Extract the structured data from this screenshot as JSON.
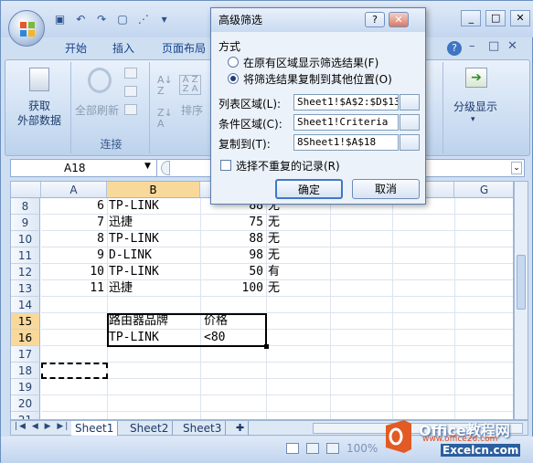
{
  "quick_access": {
    "dropdown": "▾"
  },
  "ribbon_tabs": [
    "开始",
    "插入",
    "页面布局"
  ],
  "help_icon": "?",
  "ribbon": {
    "get_external_data": "获取\n外部数据",
    "refresh_all": "全部刷新",
    "connections_group": "连接",
    "sort": "排序",
    "outline": "分级显示"
  },
  "formula_bar": {
    "name_box": "A18"
  },
  "columns": [
    "A",
    "B",
    "C",
    "D",
    "E",
    "F",
    "G"
  ],
  "rows": [
    {
      "n": "8",
      "a": "6",
      "b": "TP-LINK",
      "c": "88",
      "d": "无"
    },
    {
      "n": "9",
      "a": "7",
      "b": "迅捷",
      "c": "75",
      "d": "无"
    },
    {
      "n": "10",
      "a": "8",
      "b": "TP-LINK",
      "c": "88",
      "d": "无"
    },
    {
      "n": "11",
      "a": "9",
      "b": "D-LINK",
      "c": "98",
      "d": "无"
    },
    {
      "n": "12",
      "a": "10",
      "b": "TP-LINK",
      "c": "50",
      "d": "有"
    },
    {
      "n": "13",
      "a": "11",
      "b": "迅捷",
      "c": "100",
      "d": "无"
    },
    {
      "n": "14",
      "a": "",
      "b": "",
      "c": "",
      "d": ""
    },
    {
      "n": "15",
      "a": "",
      "b": "路由器品牌",
      "c": "价格",
      "d": ""
    },
    {
      "n": "16",
      "a": "",
      "b": "TP-LINK",
      "c": "<80",
      "d": ""
    },
    {
      "n": "17",
      "a": "",
      "b": "",
      "c": "",
      "d": ""
    },
    {
      "n": "18",
      "a": "",
      "b": "",
      "c": "",
      "d": ""
    },
    {
      "n": "19",
      "a": "",
      "b": "",
      "c": "",
      "d": ""
    },
    {
      "n": "20",
      "a": "",
      "b": "",
      "c": "",
      "d": ""
    },
    {
      "n": "21",
      "a": "",
      "b": "",
      "c": "",
      "d": ""
    }
  ],
  "sheet_tabs": [
    "Sheet1",
    "Sheet2",
    "Sheet3"
  ],
  "status": {
    "zoom": "100%"
  },
  "dialog": {
    "title": "高级筛选",
    "help": "?",
    "close": "✕",
    "method_label": "方式",
    "option1": "在原有区域显示筛选结果(F)",
    "option2": "将筛选结果复制到其他位置(O)",
    "list_range_label": "列表区域(L):",
    "list_range_value": "Sheet1!$A$2:$D$13",
    "criteria_label": "条件区域(C):",
    "criteria_value": "Sheet1!Criteria",
    "copy_to_label": "复制到(T):",
    "copy_to_value": "8Sheet1!$A$18",
    "unique_label": "选择不重复的记录(R)",
    "ok": "确定",
    "cancel": "取消"
  },
  "watermark": {
    "line1": "Office教程网",
    "line2": "www.office26.com",
    "line3": "Excelcn.com"
  }
}
